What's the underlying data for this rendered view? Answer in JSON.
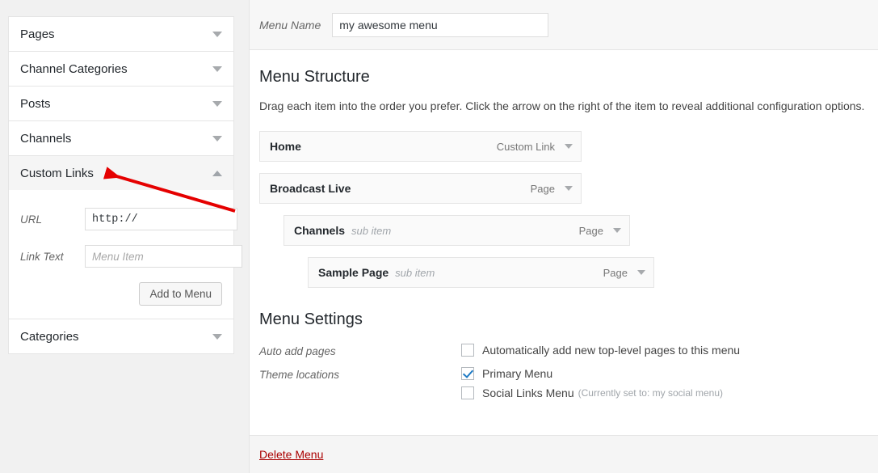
{
  "sidebar": {
    "panels": [
      {
        "label": "Pages",
        "state": "collapsed"
      },
      {
        "label": "Channel Categories",
        "state": "collapsed"
      },
      {
        "label": "Posts",
        "state": "collapsed"
      },
      {
        "label": "Channels",
        "state": "collapsed"
      },
      {
        "label": "Custom Links",
        "state": "expanded"
      },
      {
        "label": "Categories",
        "state": "collapsed"
      }
    ],
    "custom_links_form": {
      "url_label": "URL",
      "url_value": "http://",
      "link_text_label": "Link Text",
      "link_text_value": "",
      "link_text_placeholder": "Menu Item",
      "add_button_label": "Add to Menu"
    }
  },
  "main": {
    "menu_name_label": "Menu Name",
    "menu_name_value": "my awesome menu",
    "structure_title": "Menu Structure",
    "structure_desc": "Drag each item into the order you prefer. Click the arrow on the right of the item to reveal additional configuration options.",
    "menu_items": [
      {
        "title": "Home",
        "sub_label": "",
        "type": "Custom Link",
        "depth": 0
      },
      {
        "title": "Broadcast Live",
        "sub_label": "",
        "type": "Page",
        "depth": 0
      },
      {
        "title": "Channels",
        "sub_label": "sub item",
        "type": "Page",
        "depth": 1
      },
      {
        "title": "Sample Page",
        "sub_label": "sub item",
        "type": "Page",
        "depth": 2
      }
    ],
    "settings_title": "Menu Settings",
    "auto_add_label": "Auto add pages",
    "auto_add_checkbox": {
      "text": "Automatically add new top-level pages to this menu",
      "checked": false
    },
    "theme_locations_label": "Theme locations",
    "theme_locations": [
      {
        "text": "Primary Menu",
        "note": "",
        "checked": true
      },
      {
        "text": "Social Links Menu",
        "note": "(Currently set to: my social menu)",
        "checked": false
      }
    ],
    "delete_menu_label": "Delete Menu"
  },
  "annotation": {
    "color": "#e50000",
    "points_to": "Custom Links"
  }
}
